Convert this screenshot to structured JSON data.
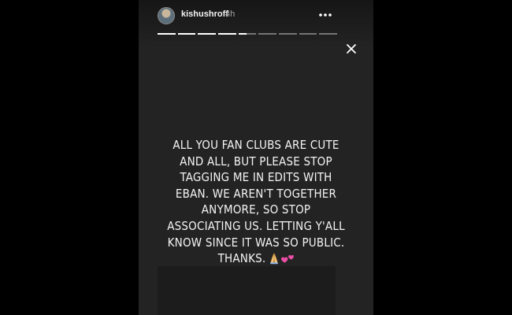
{
  "story": {
    "username": "kishushroff",
    "time": "4h",
    "progress": {
      "segments": 9,
      "completed": 4,
      "current_fraction": 0.45
    },
    "caption_lines": [
      "ALL YOU FAN CLUBS ARE CUTE",
      "AND ALL, BUT PLEASE STOP",
      "TAGGING ME IN EDITS WITH",
      "EBAN. WE AREN'T TOGETHER",
      "ANYMORE, SO STOP",
      "ASSOCIATING US. LETTING Y'ALL",
      "KNOW SINCE IT WAS SO PUBLIC.",
      "THANKS."
    ],
    "emojis": [
      "folded-hands-icon",
      "two-hearts-icon"
    ],
    "colors": {
      "background": "#232323",
      "text": "#f4f4f4",
      "progress_done": "#ffffff",
      "progress_pending": "rgba(255,255,255,0.38)",
      "heart": "#ec4fa6"
    }
  },
  "controls": {
    "more_icon": "more-horizontal-icon",
    "close_icon": "close-icon"
  }
}
